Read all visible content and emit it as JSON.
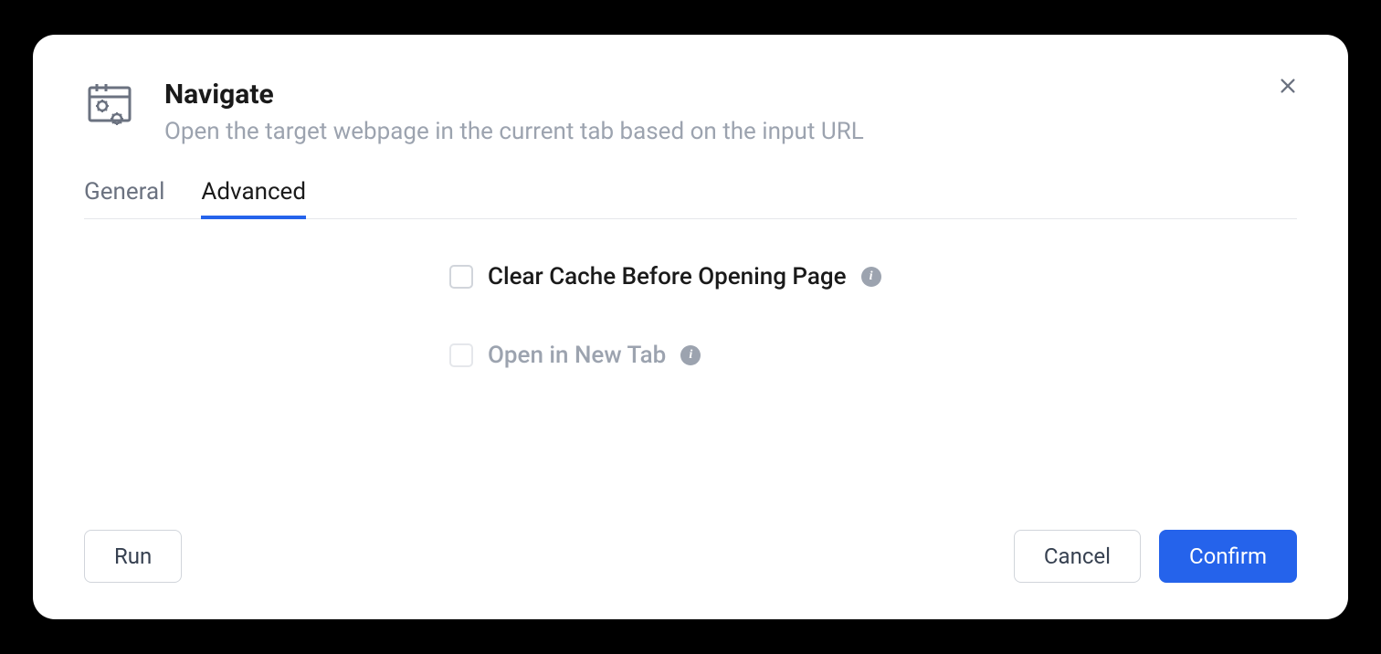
{
  "header": {
    "title": "Navigate",
    "subtitle": "Open the target webpage in the current tab based on the input URL"
  },
  "tabs": {
    "general": "General",
    "advanced": "Advanced"
  },
  "options": {
    "clear_cache": "Clear Cache Before Opening Page",
    "open_new_tab": "Open in New Tab"
  },
  "buttons": {
    "run": "Run",
    "cancel": "Cancel",
    "confirm": "Confirm"
  }
}
